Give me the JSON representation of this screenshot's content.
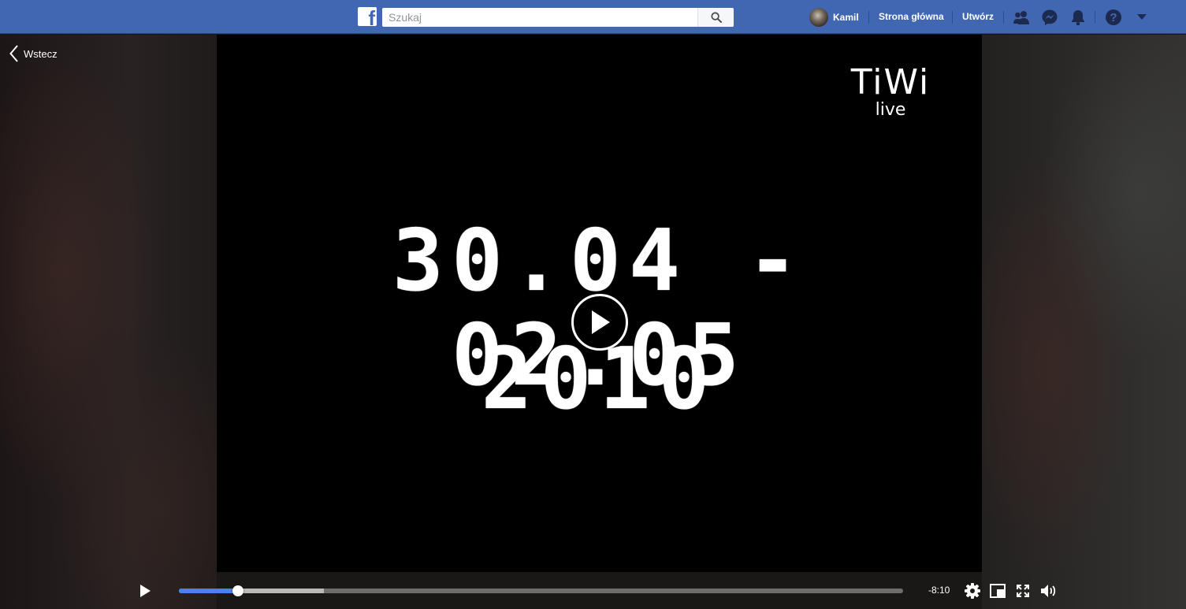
{
  "topbar": {
    "search_placeholder": "Szukaj",
    "user_name": "Kamil",
    "home_label": "Strona główna",
    "create_label": "Utwórz",
    "icons": [
      "facebook-logo-icon",
      "search-icon",
      "friends-icon",
      "messenger-icon",
      "notifications-icon",
      "help-icon",
      "account-menu-icon"
    ],
    "brand_color": "#4267b2"
  },
  "viewer": {
    "back_label": "Wstecz",
    "video": {
      "logo_main": "TiWi",
      "logo_sub": "live",
      "date_line": "30.04 - 02.05",
      "year_line": "2010"
    }
  },
  "player": {
    "time_remaining": "-8:10",
    "progress_fraction": 0.082,
    "buffered_fraction": 0.2,
    "accent_color": "#4a80f0",
    "icons": [
      "play-icon",
      "settings-icon",
      "picture-in-picture-icon",
      "fullscreen-icon",
      "volume-icon"
    ]
  }
}
